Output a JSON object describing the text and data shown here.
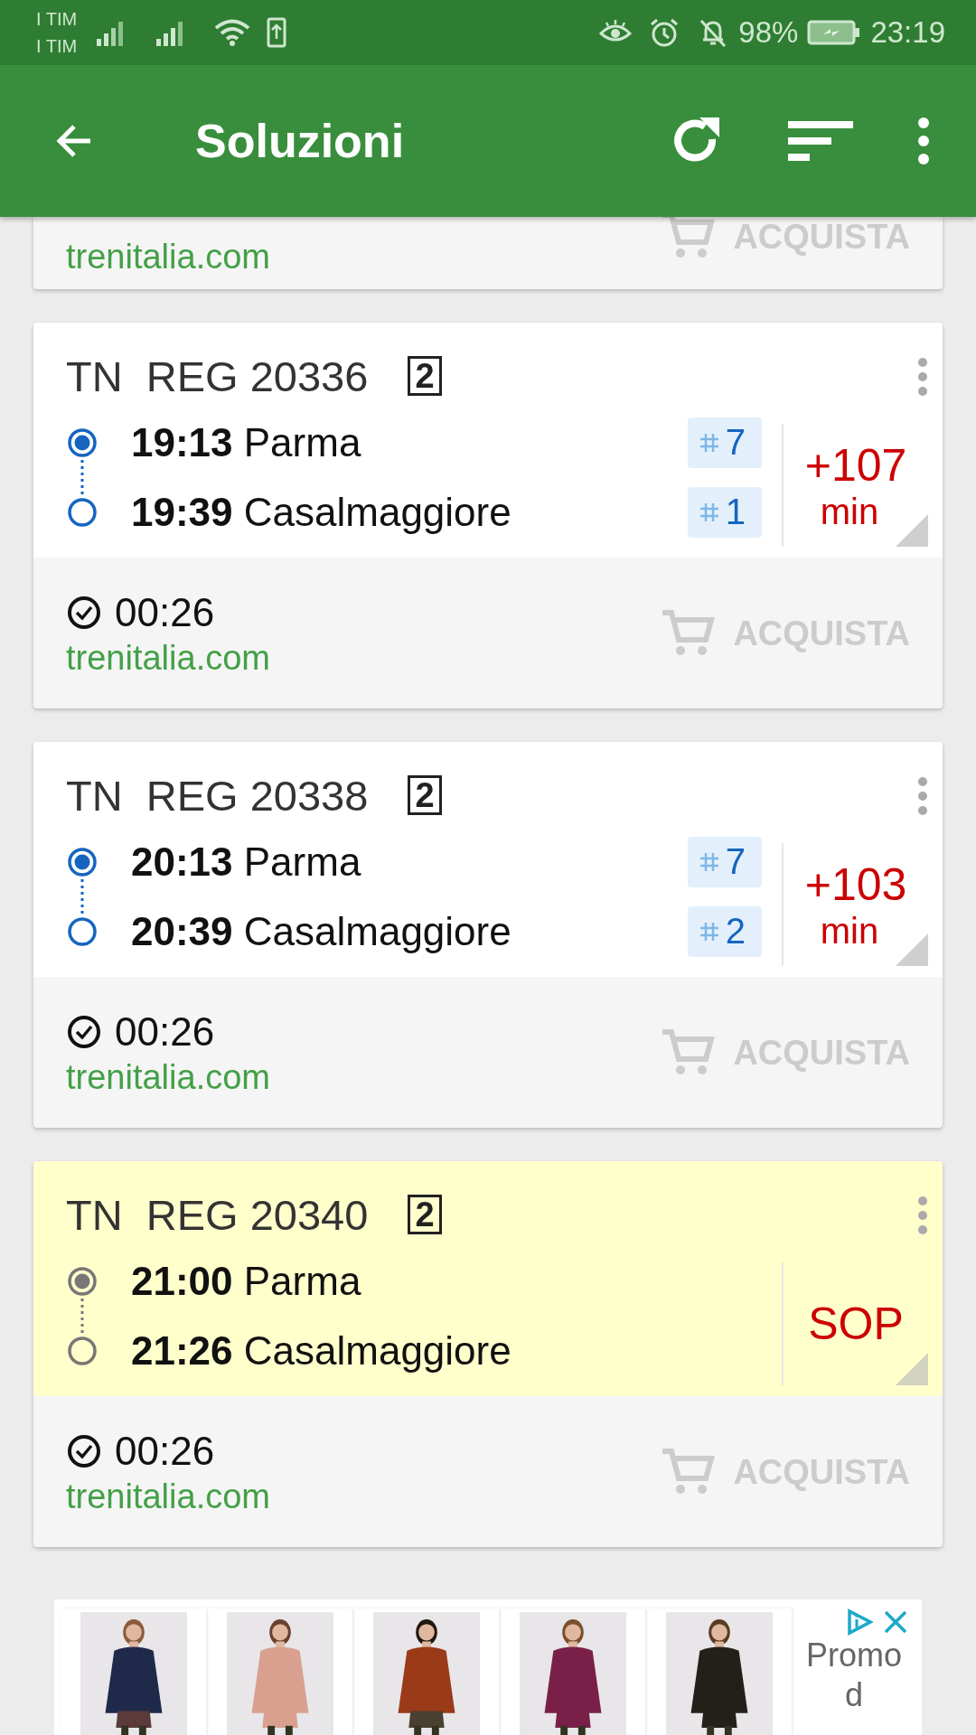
{
  "status_bar": {
    "carriers": [
      "I TIM",
      "I TIM"
    ],
    "battery": "98%",
    "time": "23:19"
  },
  "app_bar": {
    "title": "Soluzioni"
  },
  "partial_card": {
    "site": "trenitalia.com",
    "buy_label": "ACQUISTA"
  },
  "solutions": [
    {
      "kind": "delay",
      "train": "TN  REG 20336",
      "class": "2",
      "stops": [
        {
          "time": "19:13",
          "station": "Parma",
          "platform": "7"
        },
        {
          "time": "19:39",
          "station": "Casalmaggiore",
          "platform": "1"
        }
      ],
      "delay": "+107",
      "delay_unit": "min",
      "duration": "00:26",
      "site": "trenitalia.com",
      "buy_label": "ACQUISTA"
    },
    {
      "kind": "delay",
      "train": "TN  REG 20338",
      "class": "2",
      "stops": [
        {
          "time": "20:13",
          "station": "Parma",
          "platform": "7"
        },
        {
          "time": "20:39",
          "station": "Casalmaggiore",
          "platform": "2"
        }
      ],
      "delay": "+103",
      "delay_unit": "min",
      "duration": "00:26",
      "site": "trenitalia.com",
      "buy_label": "ACQUISTA"
    },
    {
      "kind": "suppressed",
      "train": "TN  REG 20340",
      "class": "2",
      "stops": [
        {
          "time": "21:00",
          "station": "Parma"
        },
        {
          "time": "21:26",
          "station": "Casalmaggiore"
        }
      ],
      "status_label": "SOP",
      "duration": "00:26",
      "site": "trenitalia.com",
      "buy_label": "ACQUISTA"
    }
  ],
  "ad": {
    "brand": "Promod"
  }
}
